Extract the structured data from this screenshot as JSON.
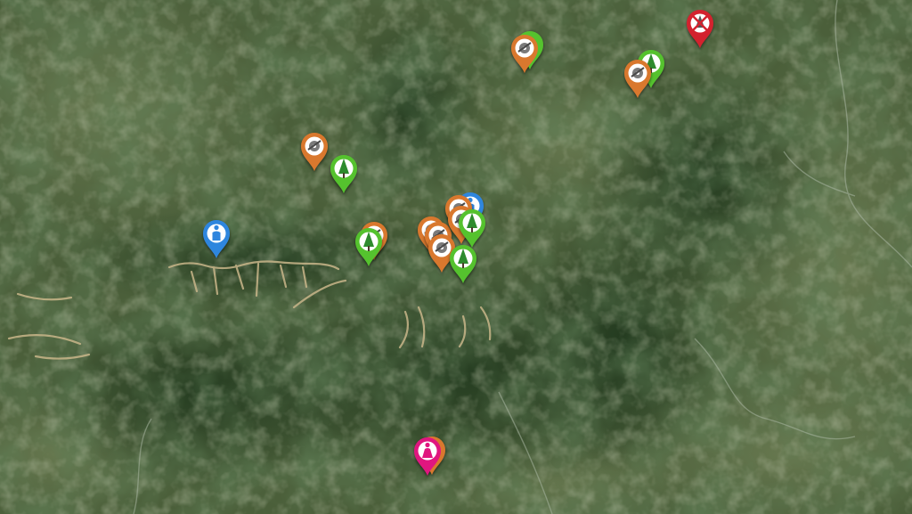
{
  "map": {
    "type": "satellite",
    "colors": {
      "sawmill": "#d9782d",
      "forest": "#55c22e",
      "person_male": "#2f86de",
      "person_female": "#e0157f",
      "blocked": "#d3232f"
    },
    "markers": [
      {
        "kind": "sawmill",
        "icon": "saw-blade-icon",
        "name": "marker-sawmill"
      },
      {
        "kind": "forest",
        "icon": "tree-icon",
        "name": "marker-forest"
      },
      {
        "kind": "sawmill",
        "icon": "saw-blade-icon",
        "name": "marker-sawmill"
      },
      {
        "kind": "forest",
        "icon": "tree-icon",
        "name": "marker-forest"
      },
      {
        "kind": "sawmill",
        "icon": "saw-blade-icon",
        "name": "marker-sawmill"
      },
      {
        "kind": "blocked",
        "icon": "crossed-tree-icon",
        "name": "marker-blocked-site"
      },
      {
        "kind": "sawmill",
        "icon": "saw-blade-icon",
        "name": "marker-sawmill"
      },
      {
        "kind": "forest",
        "icon": "tree-icon",
        "name": "marker-forest"
      },
      {
        "kind": "person_male",
        "icon": "person-icon",
        "name": "marker-person"
      },
      {
        "kind": "sawmill",
        "icon": "saw-blade-icon",
        "name": "marker-sawmill"
      },
      {
        "kind": "forest",
        "icon": "tree-icon",
        "name": "marker-forest"
      },
      {
        "kind": "person_male",
        "icon": "person-icon",
        "name": "marker-person"
      },
      {
        "kind": "sawmill",
        "icon": "saw-blade-icon",
        "name": "marker-sawmill"
      },
      {
        "kind": "sawmill",
        "icon": "saw-blade-icon",
        "name": "marker-sawmill"
      },
      {
        "kind": "sawmill",
        "icon": "saw-blade-icon",
        "name": "marker-sawmill"
      },
      {
        "kind": "forest",
        "icon": "tree-icon",
        "name": "marker-forest"
      },
      {
        "kind": "sawmill",
        "icon": "saw-blade-icon",
        "name": "marker-sawmill"
      },
      {
        "kind": "forest",
        "icon": "tree-icon",
        "name": "marker-forest"
      },
      {
        "kind": "sawmill",
        "icon": "saw-blade-icon",
        "name": "marker-sawmill"
      },
      {
        "kind": "person_female",
        "icon": "person-female-icon",
        "name": "marker-person-female"
      }
    ]
  }
}
